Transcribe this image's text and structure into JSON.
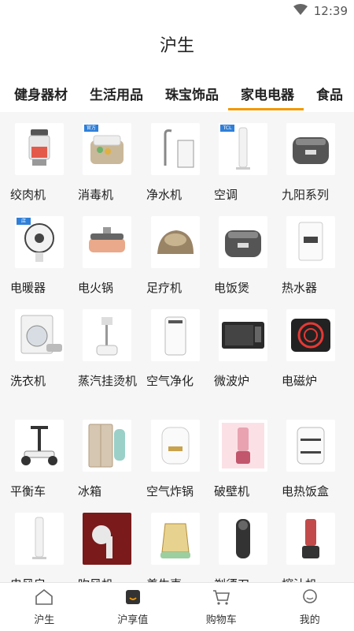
{
  "status_bar": {
    "time": "12:39",
    "icons": [
      "wifi-icon"
    ]
  },
  "app": {
    "title": "沪生"
  },
  "tabs": [
    {
      "label": "健身器材",
      "active": false
    },
    {
      "label": "生活用品",
      "active": false
    },
    {
      "label": "珠宝饰品",
      "active": false
    },
    {
      "label": "家电电器",
      "active": true
    },
    {
      "label": "食品",
      "active": false
    }
  ],
  "accent_color": "#f39800",
  "products": [
    {
      "label": "绞肉机",
      "icon": "meat-grinder-icon"
    },
    {
      "label": "消毒机",
      "icon": "sterilizer-icon",
      "badge": "官方"
    },
    {
      "label": "净水机",
      "icon": "water-purifier-icon"
    },
    {
      "label": "空调",
      "icon": "tower-fan-icon",
      "badge": "TCL"
    },
    {
      "label": "九阳系列",
      "icon": "rice-cooker-icon"
    },
    {
      "label": "电暖器",
      "icon": "heater-fan-icon",
      "badge": "店"
    },
    {
      "label": "电火锅",
      "icon": "hot-pot-icon"
    },
    {
      "label": "足疗机",
      "icon": "foot-massager-icon"
    },
    {
      "label": "电饭煲",
      "icon": "rice-cooker-icon"
    },
    {
      "label": "热水器",
      "icon": "water-heater-icon"
    },
    {
      "label": "洗衣机",
      "icon": "washing-machine-icon"
    },
    {
      "label": "蒸汽挂烫机",
      "icon": "garment-steamer-icon"
    },
    {
      "label": "空气净化",
      "icon": "air-purifier-icon"
    },
    {
      "label": "微波炉",
      "icon": "microwave-icon"
    },
    {
      "label": "电磁炉",
      "icon": "induction-cooker-icon"
    },
    {
      "label": "平衡车",
      "icon": "balance-scooter-icon"
    },
    {
      "label": "冰箱",
      "icon": "refrigerator-icon"
    },
    {
      "label": "空气炸锅",
      "icon": "air-fryer-icon"
    },
    {
      "label": "破壁机",
      "icon": "blender-icon"
    },
    {
      "label": "电热饭盒",
      "icon": "lunch-box-icon"
    },
    {
      "label": "电风扇",
      "icon": "tower-fan-icon"
    },
    {
      "label": "吹风机",
      "icon": "hair-dryer-icon"
    },
    {
      "label": "养生壶",
      "icon": "health-kettle-icon"
    },
    {
      "label": "剃须刀",
      "icon": "shaver-icon"
    },
    {
      "label": "榨汁机",
      "icon": "juicer-icon"
    }
  ],
  "bottom_nav": [
    {
      "label": "沪生",
      "icon": "home-icon"
    },
    {
      "label": "沪享值",
      "icon": "bag-icon"
    },
    {
      "label": "购物车",
      "icon": "cart-icon"
    },
    {
      "label": "我的",
      "icon": "profile-icon"
    }
  ]
}
